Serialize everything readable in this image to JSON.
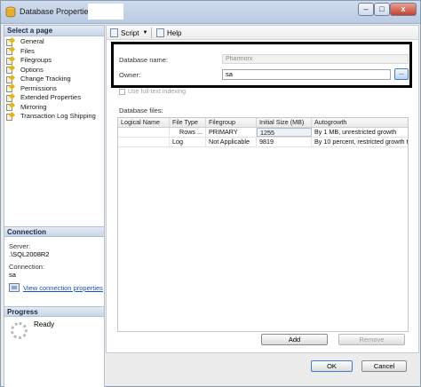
{
  "window": {
    "title": "Database Properties -",
    "controls": {
      "minimize": "–",
      "maximize": "□",
      "close": "x"
    }
  },
  "left_pane": {
    "header": "Select a page",
    "pages": [
      {
        "label": "General",
        "icon": "page-icon"
      },
      {
        "label": "Files",
        "icon": "page-icon"
      },
      {
        "label": "Filegroups",
        "icon": "page-icon"
      },
      {
        "label": "Options",
        "icon": "page-icon"
      },
      {
        "label": "Change Tracking",
        "icon": "page-icon"
      },
      {
        "label": "Permissions",
        "icon": "page-icon"
      },
      {
        "label": "Extended Properties",
        "icon": "page-icon"
      },
      {
        "label": "Mirroring",
        "icon": "page-icon"
      },
      {
        "label": "Transaction Log Shipping",
        "icon": "page-icon"
      }
    ],
    "connection": {
      "header": "Connection",
      "server_label": "Server:",
      "server_value": ".\\SQL2008R2",
      "connection_label": "Connection:",
      "connection_value": "sa",
      "view_link": "View connection properties"
    },
    "progress": {
      "header": "Progress",
      "status": "Ready"
    }
  },
  "toolbar": {
    "script_label": "Script",
    "help_label": "Help"
  },
  "form": {
    "database_name_label": "Database name:",
    "database_name_value": "Pharmorx",
    "owner_label": "Owner:",
    "owner_value": "sa",
    "browse_label": "...",
    "fulltext_label": "Use full-text indexing",
    "database_files_label": "Database files:"
  },
  "files_grid": {
    "columns": [
      "Logical Name",
      "File Type",
      "Filegroup",
      "Initial Size (MB)",
      "Autogrowth"
    ],
    "rows": [
      {
        "logical_name": "",
        "file_type": "Rows ...",
        "filegroup": "PRIMARY",
        "initial_size": "1255",
        "autogrowth": "By 1 MB, unrestricted growth"
      },
      {
        "logical_name": "",
        "file_type": "Log",
        "filegroup": "Not Applicable",
        "initial_size": "9819",
        "autogrowth": "By 10 percent, restricted growth t"
      }
    ]
  },
  "buttons": {
    "add": "Add",
    "remove": "Remove",
    "ok": "OK",
    "cancel": "Cancel"
  }
}
